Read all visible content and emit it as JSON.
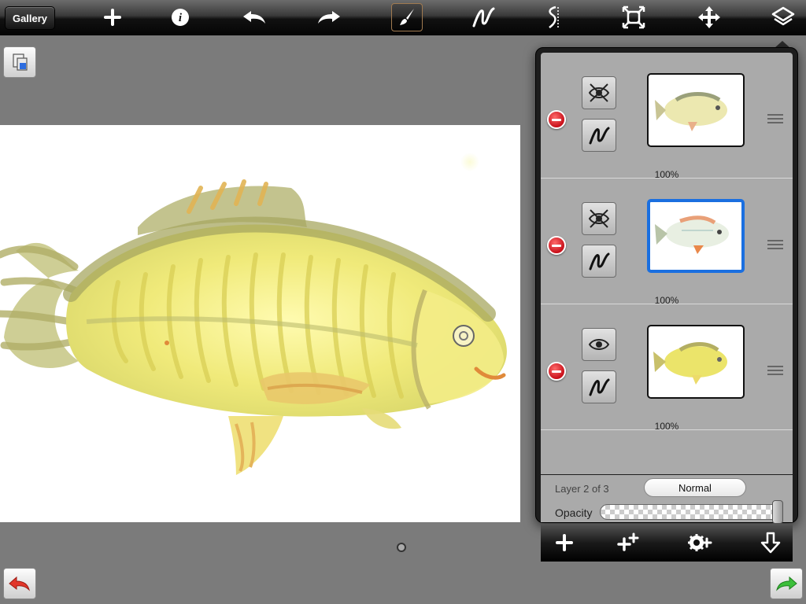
{
  "toolbar": {
    "gallery_label": "Gallery",
    "icons": [
      "add-icon",
      "info-icon",
      "undo-icon",
      "redo-icon",
      "brush-icon",
      "stroke-icon",
      "symmetry-icon",
      "transform-icon",
      "move-icon",
      "layers-icon"
    ],
    "active_tool": "brush-icon",
    "active_border_color": "#a07a50"
  },
  "side_buttons": {
    "top_left": "copy-icon",
    "bottom_left": "back-arrow-icon",
    "bottom_right": "forward-arrow-icon"
  },
  "layers_panel": {
    "layers": [
      {
        "visibility": "hidden",
        "opacity_label": "100%",
        "selected": false
      },
      {
        "visibility": "hidden",
        "opacity_label": "100%",
        "selected": true
      },
      {
        "visibility": "visible",
        "opacity_label": "100%",
        "selected": false
      }
    ],
    "layer_info": "Layer 2 of 3",
    "blend_mode": "Normal",
    "opacity_label": "Opacity",
    "opacity_value": 1.0,
    "selected_color": "#1a6fe0",
    "bottom_actions": [
      "add-layer-icon",
      "duplicate-layer-icon",
      "merge-layer-icon",
      "merge-down-icon"
    ]
  }
}
